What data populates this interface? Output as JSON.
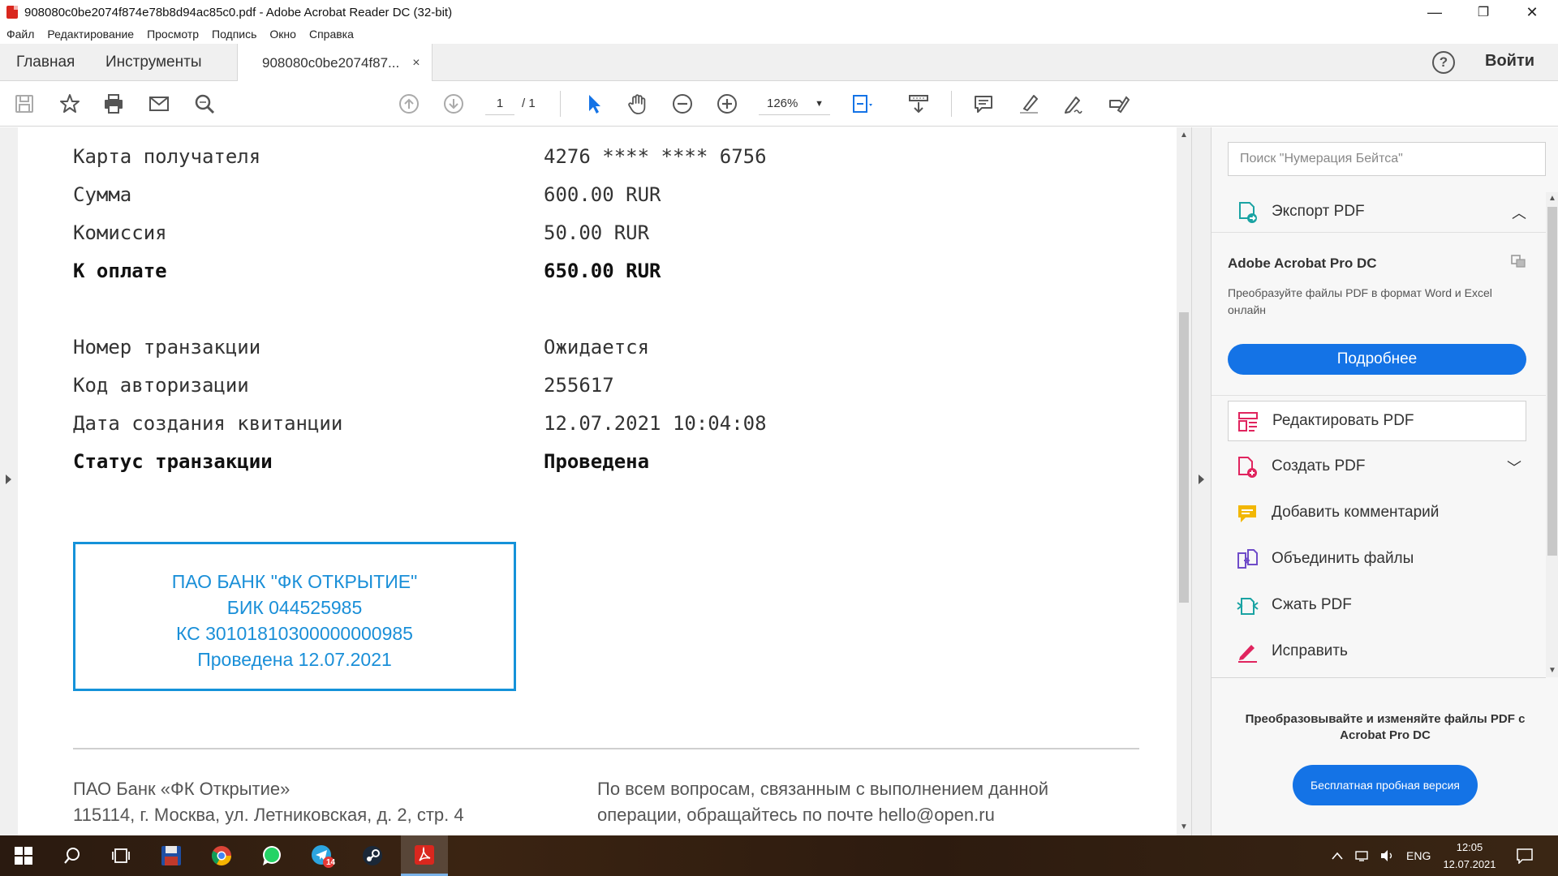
{
  "window": {
    "title": "908080c0be2074f874e78b8d94ac85c0.pdf - Adobe Acrobat Reader DC (32-bit)",
    "minimize": "—",
    "restore": "❐",
    "close": "✕"
  },
  "menu": [
    "Файл",
    "Редактирование",
    "Просмотр",
    "Подпись",
    "Окно",
    "Справка"
  ],
  "tabs": {
    "home": "Главная",
    "tools": "Инструменты",
    "document": "908080c0be2074f87...",
    "close": "×",
    "help": "?",
    "login": "Войти"
  },
  "toolbar": {
    "page_current": "1",
    "page_total": "/ 1",
    "zoom": "126%",
    "zoom_caret": "▼"
  },
  "document": {
    "rows": [
      {
        "label": "Карта получателя",
        "value": "4276 **** **** 6756",
        "bold": false
      },
      {
        "label": "Сумма",
        "value": "600.00 RUR",
        "bold": false
      },
      {
        "label": "Комиссия",
        "value": "50.00 RUR",
        "bold": false
      },
      {
        "label": "К оплате",
        "value": "650.00 RUR",
        "bold": true
      },
      {
        "label": "Номер транзакции",
        "value": "Ожидается",
        "bold": false
      },
      {
        "label": "Код авторизации",
        "value": "255617",
        "bold": false
      },
      {
        "label": "Дата создания квитанции",
        "value": "12.07.2021 10:04:08",
        "bold": false
      },
      {
        "label": "Статус транзакции",
        "value": "Проведена",
        "bold": true
      }
    ],
    "stamp": [
      "ПАО БАНК \"ФК ОТКРЫТИЕ\"",
      "БИК 044525985",
      "КС 30101810300000000985",
      "Проведена 12.07.2021"
    ],
    "footer_left": [
      "ПАО Банк «ФК Открытие»",
      "115114, г. Москва, ул. Летниковская, д. 2, стр. 4"
    ],
    "footer_right": [
      "По всем вопросам, связанным с выполнением данной",
      "операции, обращайтесь по почте hello@open.ru"
    ]
  },
  "panel": {
    "search_placeholder": "Поиск \"Нумерация Бейтса\"",
    "export_label": "Экспорт PDF",
    "export_chevron": "︿",
    "promo_title": "Adobe Acrobat Pro DC",
    "promo_desc": "Преобразуйте файлы PDF в формат Word и Excel онлайн",
    "more_button": "Подробнее",
    "tools": [
      {
        "label": "Редактировать PDF",
        "icon": "edit-pdf-icon",
        "color": "#e0245e"
      },
      {
        "label": "Создать PDF",
        "icon": "create-pdf-icon",
        "color": "#e0245e",
        "chevron": "﹀"
      },
      {
        "label": "Добавить комментарий",
        "icon": "comment-icon",
        "color": "#f2b705"
      },
      {
        "label": "Объединить файлы",
        "icon": "combine-icon",
        "color": "#6f4cc9"
      },
      {
        "label": "Сжать PDF",
        "icon": "compress-icon",
        "color": "#1aa3a3"
      },
      {
        "label": "Исправить",
        "icon": "fix-icon",
        "color": "#e0245e"
      }
    ],
    "trial_text": "Преобразовывайте и изменяйте файлы PDF с Acrobat Pro DC",
    "trial_button": "Бесплатная пробная версия"
  },
  "taskbar": {
    "telegram_badge": "14",
    "lang": "ENG",
    "time": "12:05",
    "date": "12.07.2021"
  },
  "colors": {
    "accent": "#1473e6",
    "stamp": "#1592d9",
    "pdf_red": "#d9271e"
  }
}
